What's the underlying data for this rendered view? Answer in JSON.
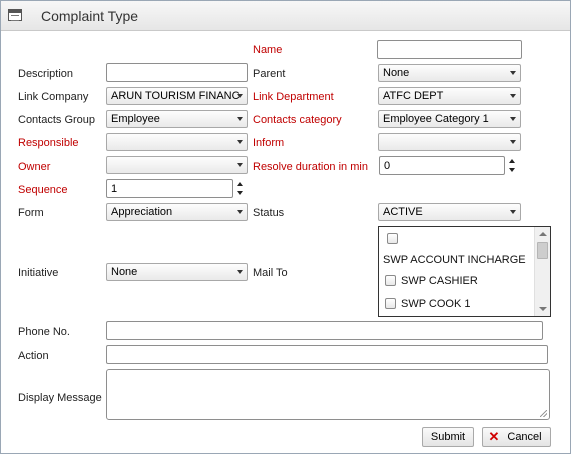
{
  "window": {
    "title": "Complaint Type",
    "icon": "form-window-icon"
  },
  "labels": {
    "name": "Name",
    "description": "Description",
    "parent": "Parent",
    "link_company": "Link Company",
    "link_department": "Link Department",
    "contacts_group": "Contacts Group",
    "contacts_category": "Contacts category",
    "responsible": "Responsible",
    "inform": "Inform",
    "owner": "Owner",
    "resolve_duration": "Resolve duration in min",
    "sequence": "Sequence",
    "form": "Form",
    "status": "Status",
    "initiative": "Initiative",
    "mail_to": "Mail To",
    "phone": "Phone No.",
    "action": "Action",
    "display_message": "Display Message"
  },
  "fields": {
    "name": "",
    "description": "",
    "parent": "Parent",
    "parent_value": "None",
    "link_company": "ARUN TOURISM FINANC",
    "link_department": "ATFC DEPT",
    "contacts_group": "Employee",
    "contacts_category": "Employee Category 1",
    "responsible": "",
    "inform": "",
    "owner": "",
    "resolve_duration": "0",
    "sequence": "1",
    "form": "Appreciation",
    "status": "ACTIVE",
    "initiative": "None",
    "phone": "",
    "action": "",
    "display_message": ""
  },
  "mail_to": {
    "items": [
      {
        "label": "",
        "checked": false
      },
      {
        "label": "SWP ACCOUNT INCHARGE",
        "checked": false
      },
      {
        "label": "SWP CASHIER",
        "checked": false
      },
      {
        "label": "SWP COOK 1",
        "checked": false
      }
    ]
  },
  "buttons": {
    "submit": "Submit",
    "cancel": "Cancel"
  },
  "colors": {
    "required_label": "#c00000",
    "cancel_icon": "#d00000"
  }
}
